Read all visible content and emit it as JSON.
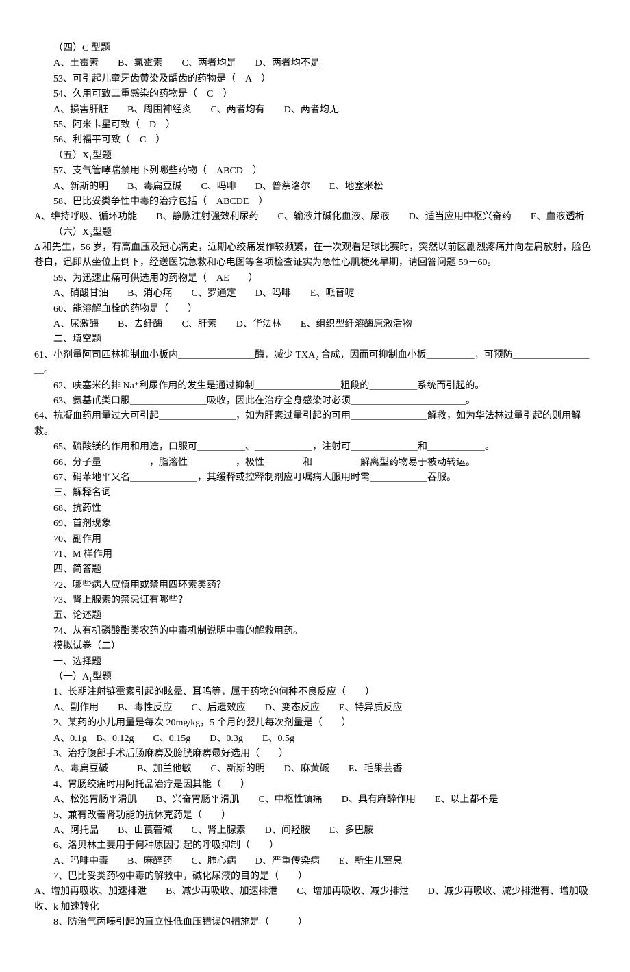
{
  "lines": [
    "（四）C 型题",
    "A、土霉素　　B、氯霉素　　C、两者均是　　D、两者均不是",
    "53、可引起儿童牙齿黄染及龋齿的药物是（　A　）",
    "54、久用可致二重感染的药物是（　C　）",
    "A、损害肝脏　　B、周围神经炎　　C、两者均有　　D、两者均无",
    "55、阿米卡星可致（　D　）",
    "56、利福平可致（　C　）",
    "（五）X₁型题",
    "57、支气管哮喘禁用下列哪些药物（　ABCD　）",
    "A、新斯的明　　B、毒扁豆碱　　C、吗啡　　D、普萘洛尔　　E、地塞米松",
    "58、巴比妥类争性中毒的治疗包括（　ABCDE　）",
    "A、维持呼吸、循环功能　　B、静脉注射强效利尿药　　C、输液并碱化血液、尿液　　D、适当应用中枢兴奋药　　E、血液透析",
    "（六）X₂型题",
    "Δ 和先生，56 岁，有高血压及冠心病史，近期心绞痛发作较频繁，在一次观看足球比赛时，突然以前区剧烈疼痛并向左肩放射，脸色苍白，迅即从坐位上倒下，经送医院急救和心电图等各项检查证实为急性心肌梗死早期，请回答问题 59－60。",
    "59、为迅速止痛可供选用的药物是（　AE　　）",
    "A、硝酸甘油　　B、消心痛　　C、罗通定　　D、吗啡　　E、哌替啶",
    "60、能溶解血栓的药物是（　　）",
    "A、尿激酶　　B、去纤酶　　C、肝素　　D、华法林　　E、组织型纤溶酶原激活物",
    "二、填空题",
    "61、小剂量阿司匹林抑制血小板内＿＿＿＿＿＿＿＿酶，减少 TXA₂ 合成，因而可抑制血小板＿＿＿＿＿，可预防＿＿＿＿＿＿＿＿＿。",
    "62、呋塞米的排 Na⁺利尿作用的发生是通过抑制＿＿＿＿＿＿＿＿＿粗段的＿＿＿＿＿系统而引起的。",
    "63、氨基甙类口服＿＿＿＿＿＿＿＿吸收，因此在治疗全身感染时必须＿＿＿＿＿＿＿＿＿＿＿＿。",
    "64、抗凝血药用量过大可引起＿＿＿＿＿＿＿＿，如为肝素过量引起的可用＿＿＿＿＿＿＿＿解救，如为华法林过量引起的则用解救。",
    "65、硫酸镁的作用和用途，口服可＿＿＿＿＿、＿＿＿＿＿＿，注射可＿＿＿＿＿＿＿和＿＿＿＿＿＿。",
    "66、分子量＿＿＿＿＿，脂溶性＿＿＿＿＿，极性＿＿＿＿和＿＿＿＿＿解离型药物易于被动转运。",
    "67、硝苯地平又名＿＿＿＿＿＿＿，其缓释或控释制剂应叮嘱病人服用时需＿＿＿＿＿＿吞服。",
    "三、解释名词",
    "68、抗药性",
    "69、首剂现象",
    "70、副作用",
    "71、M 样作用",
    "四、简答题",
    "72、哪些病人应慎用或禁用四环素类药？",
    "73、肾上腺素的禁忌证有哪些？",
    "五、论述题",
    "74、从有机磷酸酯类农药的中毒机制说明中毒的解救用药。",
    "模拟试卷（二）",
    "一、选择题",
    "（一）A₁型题",
    "1、长期注射链霉素引起的眩晕、耳鸣等，属于药物的何种不良反应（　　）",
    "A、副作用　　B、毒性反应　　C、后遗效应　　D、变态反应　　E、特异质反应",
    "2、某药的小儿用量是每次 20mg/kg，5 个月的婴儿每次剂量是（　　）",
    "A、0.1g　B、0.12g　　C、0.15g　　D、0.3g　　E、0.5g",
    "3、治疗腹部手术后肠麻痹及膀胱麻痹最好选用（　　）",
    "A、毒扁豆碱　　　B、加兰他敏　　C、新斯的明　　D、麻黄碱　　E、毛果芸香",
    "4、胃肠绞痛时用阿托品治疗是因其能（　　）",
    "A、松弛胃肠平滑肌　　B、兴奋胃肠平滑肌　　C、中枢性镇痛　　D、具有麻醉作用　　E、以上都不是",
    "5、兼有改善肾功能的抗休克药是（　　）",
    "A、阿托品　　B、山莨菪碱　　C、肾上腺素　　D、间羟胺　　E、多巴胺",
    "6、洛贝林主要用于何种原因引起的呼吸抑制（　　）",
    "A、吗啡中毒　　B、麻醉药　　C、肺心病　　D、严重传染病　　E、新生儿窒息",
    "7、巴比妥类药物中毒的解救中，碱化尿液的目的是（　　）",
    "A、增加再吸收、加速排泄　　B、减少再吸收、加速排泄　　C、增加再吸收、减少排泄　　D、减少再吸收、减少排泄有、增加吸收、k 加速转化",
    "8、防治气丙嗪引起的直立性低血压错误的措施是（　　　）"
  ]
}
